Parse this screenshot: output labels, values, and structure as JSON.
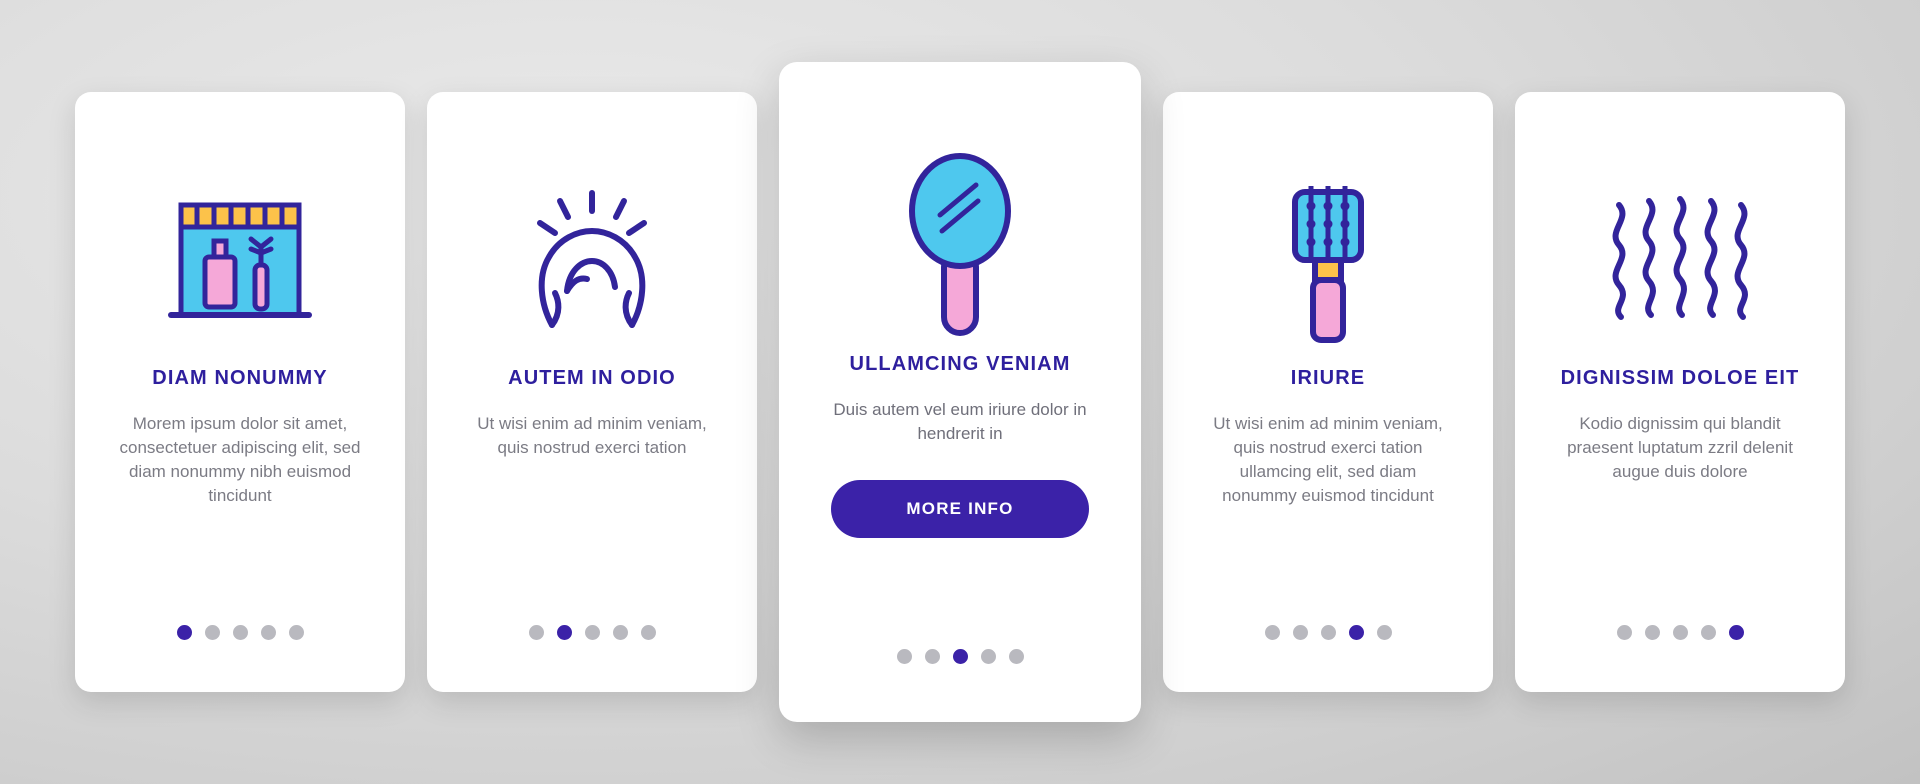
{
  "background": {
    "color_top_left": "#eaeaea",
    "color_bottom_right": "#c2c2c2"
  },
  "theme": {
    "accent": "#3b22a8",
    "title_color": "#2e1f9e",
    "body_color": "#7b7b84",
    "dot_inactive": "#b9b9bf",
    "icon_stroke": "#32249b",
    "icon_fill_cyan": "#4ec8ee",
    "icon_fill_pink": "#f5a8d8",
    "icon_fill_yellow": "#fcc24a",
    "card_bg": "#ffffff"
  },
  "cards": [
    {
      "id": "card-1",
      "icon": "beauty-shop-storefront-icon",
      "title": "DIAM NONUMMY",
      "body": "Morem ipsum dolor sit amet, consectetuer adipiscing elit, sed diam nonummy nibh euismod tincidunt",
      "featured": false,
      "dots": [
        true,
        false,
        false,
        false,
        false
      ]
    },
    {
      "id": "card-2",
      "icon": "wig-hairstyle-icon",
      "title": "AUTEM IN ODIO",
      "body": "Ut wisi enim ad minim veniam, quis nostrud exerci tation",
      "featured": false,
      "dots": [
        false,
        true,
        false,
        false,
        false
      ]
    },
    {
      "id": "card-3",
      "icon": "hand-mirror-icon",
      "title": "ULLAMCING VENIAM",
      "body": "Duis autem vel eum iriure dolor in hendrerit in",
      "featured": true,
      "cta_label": "MORE INFO",
      "dots": [
        false,
        false,
        true,
        false,
        false
      ]
    },
    {
      "id": "card-4",
      "icon": "hair-brush-icon",
      "title": "IRIURE",
      "body": "Ut wisi enim ad minim veniam, quis nostrud exerci tation ullamcing elit, sed diam nonummy euismod tincidunt",
      "featured": false,
      "dots": [
        false,
        false,
        false,
        true,
        false
      ]
    },
    {
      "id": "card-5",
      "icon": "wavy-hair-icon",
      "title": "DIGNISSIM DOLOE EIT",
      "body": "Kodio dignissim qui blandit praesent luptatum zzril delenit augue duis dolore",
      "featured": false,
      "dots": [
        false,
        false,
        false,
        false,
        true
      ]
    }
  ]
}
